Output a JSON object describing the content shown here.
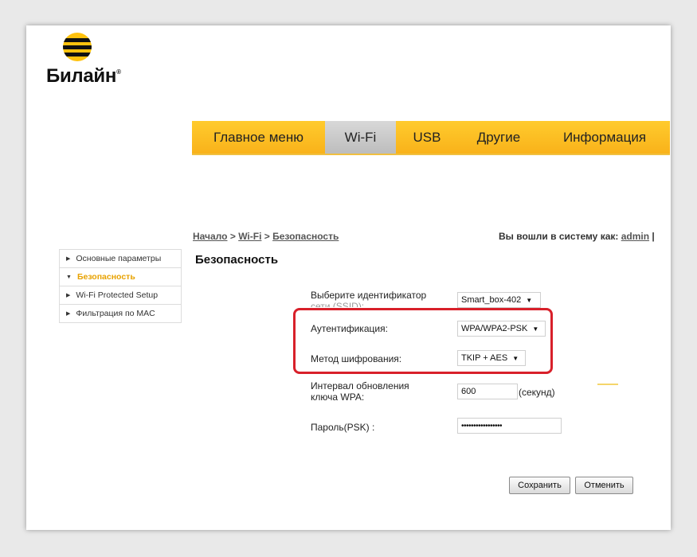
{
  "brand": {
    "logo_text": "Билайн",
    "trademark": "®"
  },
  "nav": {
    "items": [
      "Главное меню",
      "Wi-Fi",
      "USB",
      "Другие",
      "Информация"
    ],
    "active": "Wi-Fi"
  },
  "breadcrumb": {
    "home": "Начало",
    "section": "Wi-Fi",
    "current": "Безопасность",
    "sep": ">"
  },
  "login": {
    "prefix": "Вы вошли в систему как:",
    "user": "admin",
    "suffix": "|"
  },
  "sidebar": {
    "items": [
      {
        "label": "Основные параметры"
      },
      {
        "label": "Безопасность",
        "active": true
      },
      {
        "label": "Wi-Fi Protected Setup"
      },
      {
        "label": "Фильтрация по MAC"
      }
    ]
  },
  "page_title": "Безопасность",
  "form": {
    "ssid": {
      "label_line1": "Выберите идентификатор",
      "label_line2": "сети (SSID):",
      "value": "Smart_box-402"
    },
    "auth": {
      "label": "Аутентификация:",
      "value": "WPA/WPA2-PSK"
    },
    "encryption": {
      "label": "Метод шифрования:",
      "value": "TKIP + AES"
    },
    "interval": {
      "label_line1": "Интервал обновления",
      "label_line2": "ключа WPA:",
      "value": "600",
      "unit": "(секунд)"
    },
    "password": {
      "label": "Пароль(PSK) :",
      "value": "•••••••••••••••••"
    }
  },
  "buttons": {
    "save": "Сохранить",
    "cancel": "Отменить"
  },
  "colors": {
    "accent": "#f9b21a",
    "highlight": "#d8202a",
    "active_link": "#e8a200"
  }
}
